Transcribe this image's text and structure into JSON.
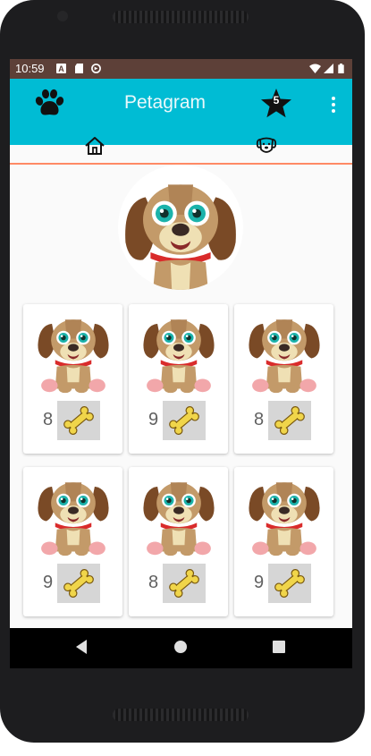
{
  "status_bar": {
    "time": "10:59",
    "left_icons": [
      "a-icon",
      "sd-card-icon",
      "sync-icon"
    ],
    "right_icons": [
      "wifi-icon",
      "signal-icon",
      "battery-icon"
    ]
  },
  "app_bar": {
    "title": "Petagram",
    "logo_icon": "paw-icon",
    "favorites_count": "5",
    "favorites_icon": "star-icon",
    "menu_icon": "more-vert-icon",
    "color": "#00bcd4"
  },
  "tabs": [
    {
      "icon": "home-icon",
      "selected": true
    },
    {
      "icon": "dog-face-icon",
      "selected": false
    }
  ],
  "profile": {
    "image": "puppy-avatar"
  },
  "photos": [
    {
      "likes": "8"
    },
    {
      "likes": "9"
    },
    {
      "likes": "8"
    },
    {
      "likes": "9"
    },
    {
      "likes": "8"
    },
    {
      "likes": "9"
    }
  ],
  "like_icon": "bone-icon",
  "system_nav": [
    "back-icon",
    "home-circle-icon",
    "recents-icon"
  ]
}
